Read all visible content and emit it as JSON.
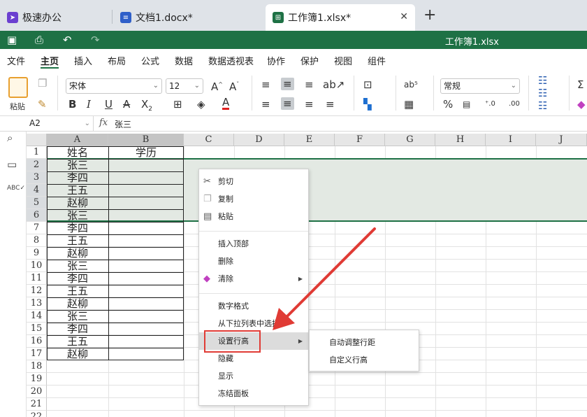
{
  "tabs": [
    {
      "label": "极速办公",
      "icon": "rocket-icon"
    },
    {
      "label": "文档1.docx*",
      "icon": "word-doc-icon"
    },
    {
      "label": "工作簿1.xlsx*",
      "icon": "spreadsheet-icon",
      "active": true
    }
  ],
  "titlebar": {
    "doc_title": "工作簿1.xlsx"
  },
  "menu": [
    "文件",
    "主页",
    "插入",
    "布局",
    "公式",
    "数据",
    "数据透视表",
    "协作",
    "保护",
    "视图",
    "组件"
  ],
  "toolbar": {
    "paste_label": "粘贴",
    "font_name": "宋体",
    "font_size": "12",
    "number_format": "常规",
    "percent": "%"
  },
  "formula_bar": {
    "cell_ref": "A2",
    "fx": "fx",
    "value": "张三"
  },
  "columns": [
    "A",
    "B",
    "C",
    "D",
    "E",
    "F",
    "G",
    "H",
    "I",
    "J"
  ],
  "rows": [
    "1",
    "2",
    "3",
    "4",
    "5",
    "6",
    "7",
    "8",
    "9",
    "10",
    "11",
    "12",
    "13",
    "14",
    "15",
    "16",
    "17",
    "18",
    "19",
    "20",
    "21",
    "22"
  ],
  "cells": {
    "A1": "姓名",
    "B1": "学历",
    "A": [
      "张三",
      "李四",
      "王五",
      "赵柳",
      "张三",
      "李四",
      "王五",
      "赵柳",
      "张三",
      "李四",
      "王五",
      "赵柳",
      "张三",
      "李四",
      "王五",
      "赵柳"
    ]
  },
  "context_menu": {
    "items": [
      "剪切",
      "复制",
      "粘贴",
      "插入顶部",
      "删除",
      "清除",
      "数字格式",
      "从下拉列表中选择",
      "设置行高",
      "隐藏",
      "显示",
      "冻结面板"
    ],
    "submenu": [
      "自动调整行距",
      "自定义行高"
    ]
  },
  "colors": {
    "accent": "#1e7145",
    "highlight_box": "#e03b35",
    "arrow": "#e03b35"
  }
}
